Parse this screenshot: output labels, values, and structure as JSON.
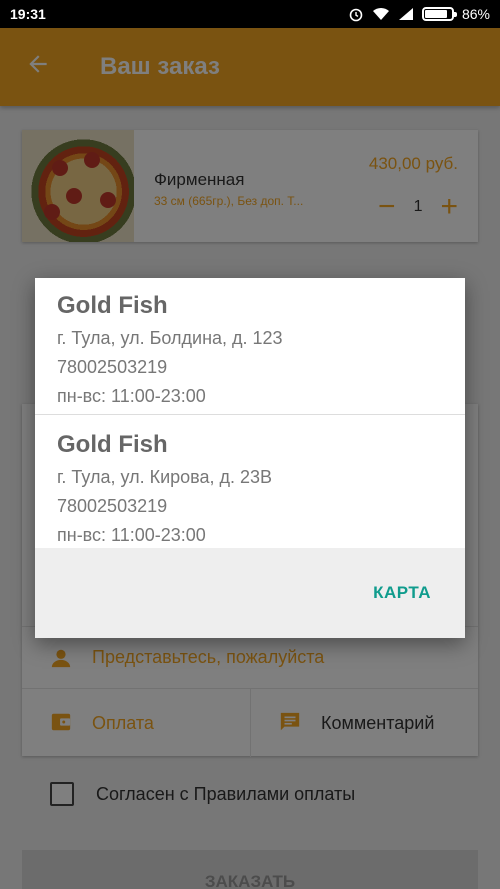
{
  "status_bar": {
    "time": "19:31",
    "battery": "86%",
    "battery_level": 0.86
  },
  "app_bar": {
    "title": "Ваш заказ",
    "back_icon": "arrow-left-icon"
  },
  "cart_item": {
    "name": "Фирменная",
    "description": "33 см (665гр.), Без доп. Т...",
    "price": "430,00 руб.",
    "quantity": "1",
    "decrease_symbol": "−",
    "increase_symbol": "+"
  },
  "form": {
    "name_placeholder": "Представьтесь, пожалуйста",
    "payment_label": "Оплата",
    "comment_label": "Комментарий"
  },
  "agreement": {
    "label": "Согласен с Правилами оплаты",
    "checked": false
  },
  "order_button": {
    "label": "ЗАКАЗАТЬ"
  },
  "dialog": {
    "branches": [
      {
        "name": "Gold Fish",
        "address": "г. Тула, ул. Болдина, д. 123",
        "phone": "78002503219",
        "hours": "пн-вс: 11:00-23:00"
      },
      {
        "name": "Gold Fish",
        "address": "г. Тула, ул. Кирова, д. 23В",
        "phone": "78002503219",
        "hours": "пн-вс: 11:00-23:00"
      }
    ],
    "map_button": "КАРТА"
  },
  "colors": {
    "accent": "#f5a623",
    "teal": "#109c8d"
  }
}
